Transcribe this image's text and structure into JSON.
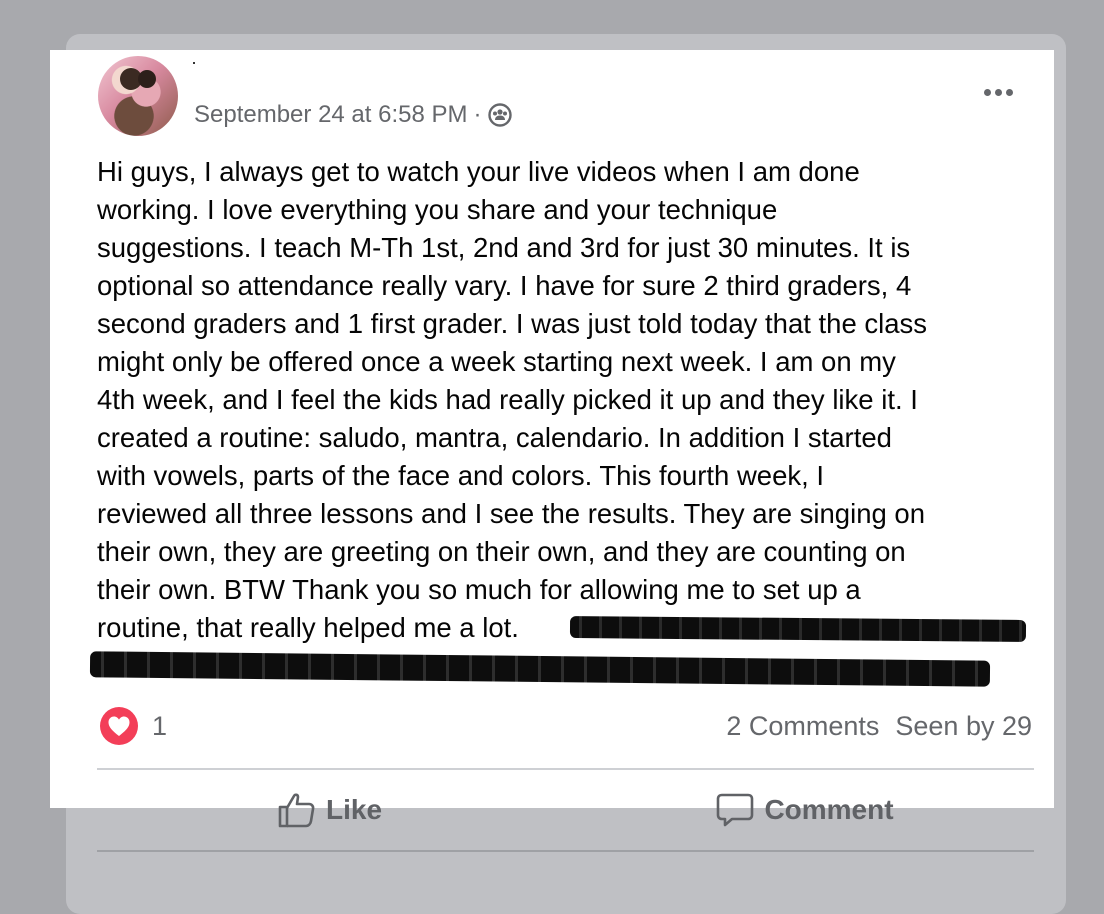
{
  "post": {
    "timestamp": "September 24 at 6:58 PM",
    "separator": "·",
    "privacy_icon": "group-icon",
    "body": "Hi guys, I always get to watch your live videos when I am done\nworking. I love everything you share and your technique\nsuggestions. I teach M-Th 1st, 2nd and 3rd for just 30 minutes. It is\noptional so attendance really vary. I have for sure 2 third graders, 4\nsecond graders and 1 first grader. I was just told today that the class\nmight only be offered once a week starting next week. I am on my\n4th week, and I feel the kids had really picked it up and they like it. I\ncreated a routine: saludo, mantra, calendario. In addition I started\nwith vowels, parts of the face and colors. This fourth week, I\nreviewed all three lessons and I see the results. They are singing on\ntheir own, they are greeting on their own, and they are counting on\ntheir own. BTW Thank you so much for allowing me to set up a\nroutine, that really helped me a lot."
  },
  "reactions": {
    "icon": "heart-icon",
    "count": "1",
    "color": "#f33e58"
  },
  "stats": {
    "comments": "2 Comments",
    "seen_by": "Seen by 29"
  },
  "actions": {
    "like_label": "Like",
    "comment_label": "Comment"
  }
}
